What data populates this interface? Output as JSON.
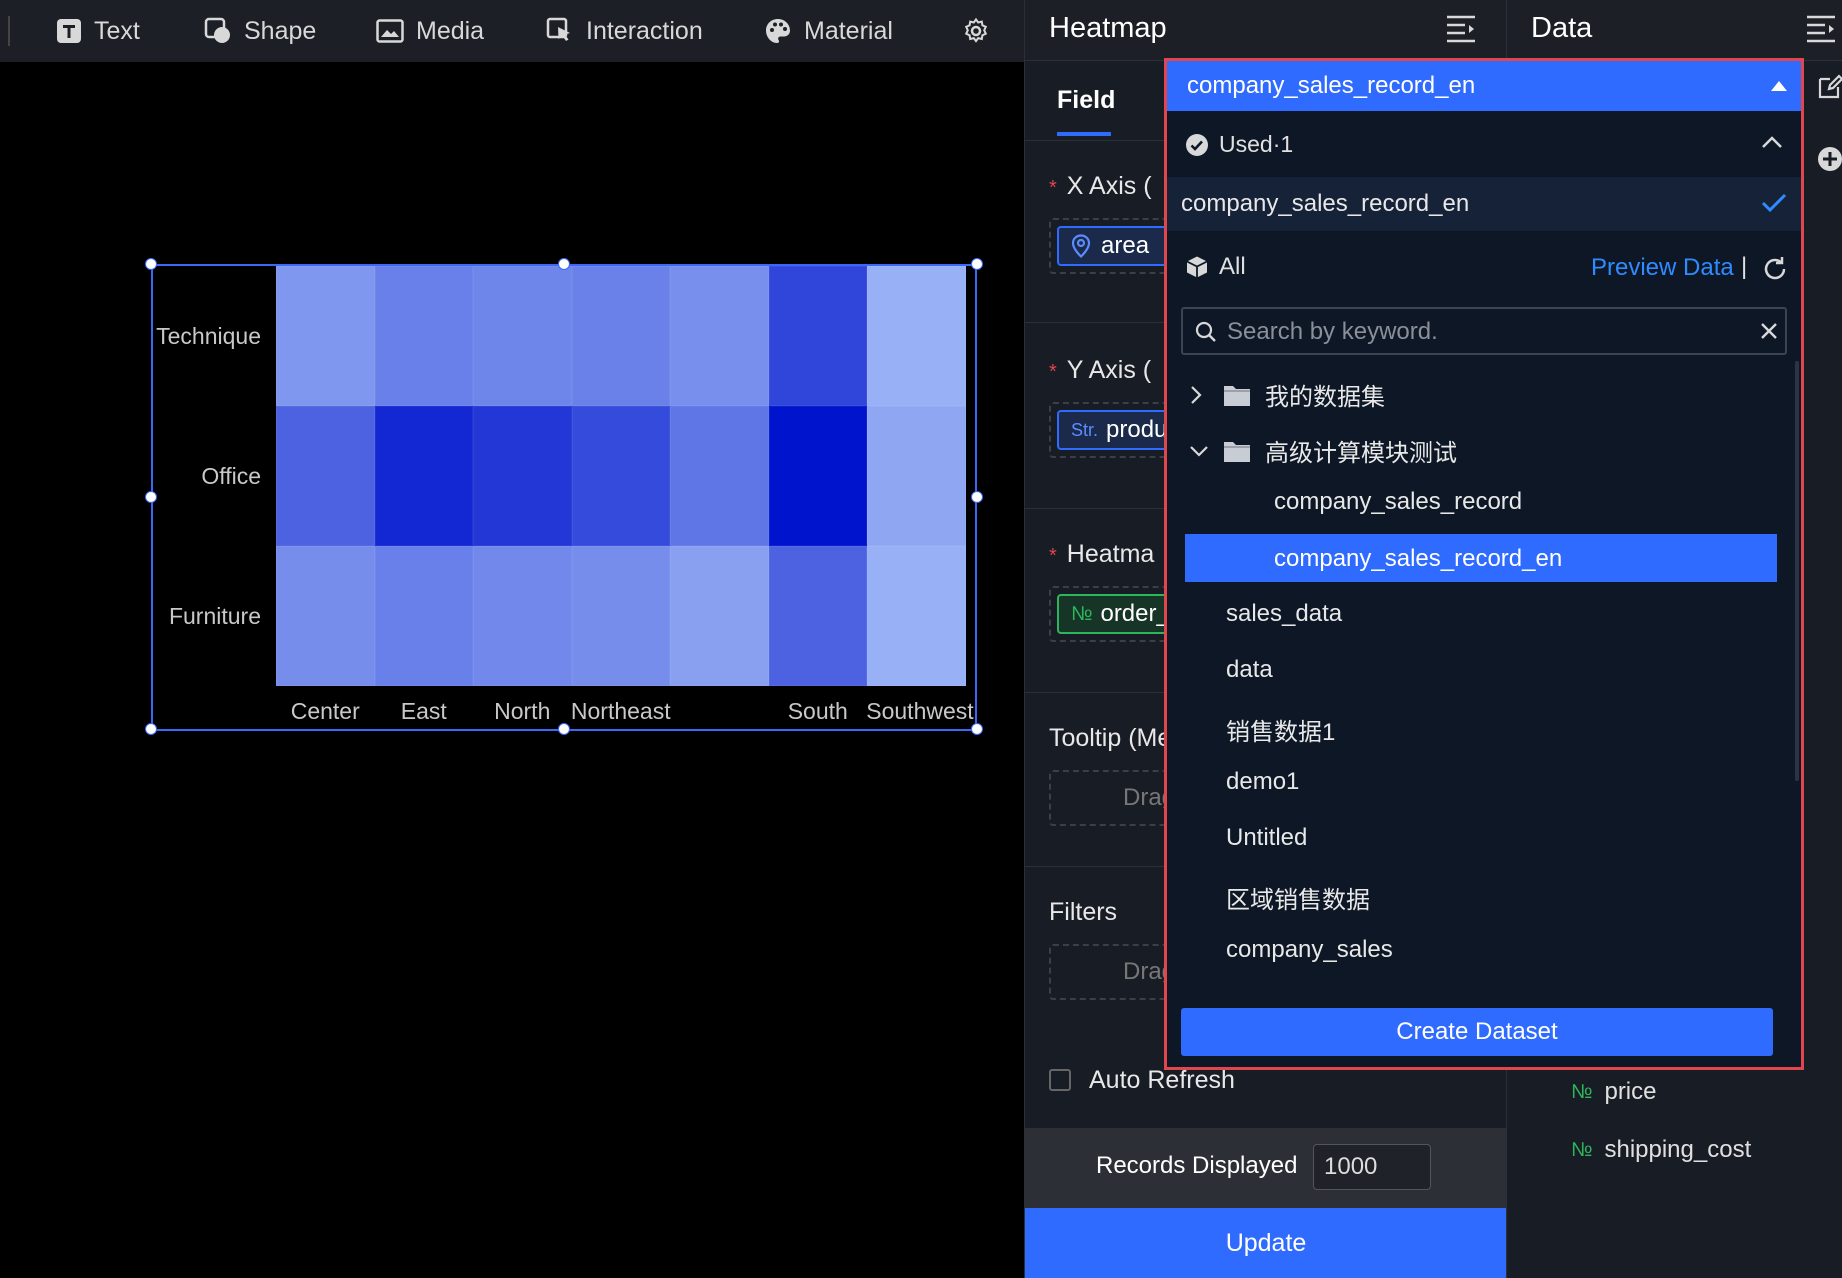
{
  "toolbar": {
    "items": [
      {
        "label": "Text",
        "icon": "text-icon"
      },
      {
        "label": "Shape",
        "icon": "shape-icon"
      },
      {
        "label": "Media",
        "icon": "media-icon"
      },
      {
        "label": "Interaction",
        "icon": "interaction-icon"
      },
      {
        "label": "Material",
        "icon": "palette-icon"
      }
    ],
    "settings_icon": "gear-icon"
  },
  "chart_data": {
    "type": "heatmap",
    "categories_y": [
      "Technique",
      "Office",
      "Furniture"
    ],
    "categories_x": [
      "Center",
      "East",
      "North",
      "Northeast",
      "",
      "South",
      "Southwest"
    ],
    "values": [
      [
        0.33,
        0.45,
        0.42,
        0.44,
        0.37,
        0.75,
        0.2
      ],
      [
        0.6,
        0.9,
        0.82,
        0.72,
        0.5,
        1.0,
        0.25
      ],
      [
        0.38,
        0.45,
        0.4,
        0.38,
        0.28,
        0.6,
        0.2
      ]
    ]
  },
  "config": {
    "title": "Heatmap",
    "tab": "Field",
    "x_axis_label": "X Axis (",
    "x_axis_chip": "area",
    "y_axis_label": "Y Axis (",
    "y_axis_chip": "produ",
    "y_axis_chip_tag": "Str.",
    "heatmap_label": "Heatma",
    "heatmap_chip": "order_",
    "heatmap_chip_tag": "№",
    "tooltip_label": "Tooltip (Me",
    "tooltip_drag": "Drag",
    "filters_label": "Filters",
    "filters_drag": "Drag",
    "auto_refresh": "Auto Refresh",
    "records_label": "Records Displayed",
    "records_value": "1000",
    "update_button": "Update"
  },
  "data_panel": {
    "title": "Data",
    "fields": [
      {
        "tag": "№",
        "name": "price"
      },
      {
        "tag": "№",
        "name": "shipping_cost"
      }
    ]
  },
  "dropdown": {
    "selected": "company_sales_record_en",
    "used_label": "Used·1",
    "used_item": "company_sales_record_en",
    "all_label": "All",
    "preview_label": "Preview Data",
    "pipe": "|",
    "search_placeholder": "Search by keyword.",
    "folders": [
      {
        "name": "我的数据集",
        "expanded": false
      },
      {
        "name": "高级计算模块测试",
        "expanded": true
      }
    ],
    "folder_children": [
      "company_sales_record",
      "company_sales_record_en"
    ],
    "items": [
      "sales_data",
      "data",
      "销售数据1",
      "demo1",
      "Untitled",
      "区域销售数据",
      "company_sales"
    ],
    "create_button": "Create Dataset"
  }
}
